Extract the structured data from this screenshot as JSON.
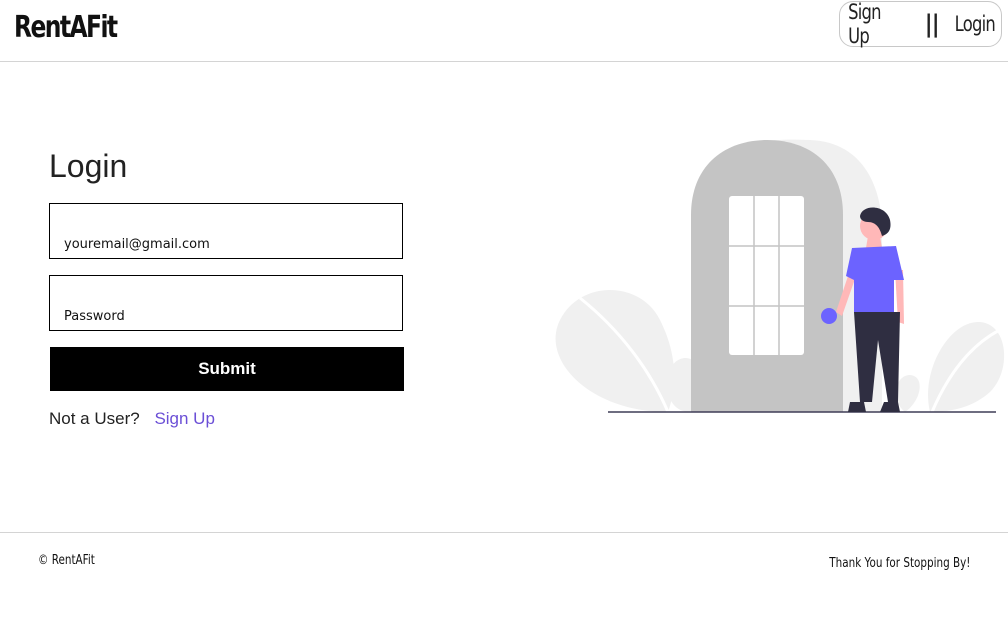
{
  "header": {
    "brand": "RentAFit",
    "nav": {
      "signup_label": "Sign Up",
      "separator": "||",
      "login_label": "Login"
    }
  },
  "login": {
    "title": "Login",
    "email_placeholder": "youremail@gmail.com",
    "password_placeholder": "Password",
    "submit_label": "Submit",
    "prompt_text": "Not a User?",
    "signup_link": "Sign Up"
  },
  "footer": {
    "copyright": "© RentAFit",
    "thanks": "Thank You for Stopping By!"
  },
  "colors": {
    "accent": "#6c63ff",
    "link": "#6b4fd6",
    "button_bg": "#000000",
    "door": "#c4c4c4",
    "foliage": "#f0f0f0"
  }
}
